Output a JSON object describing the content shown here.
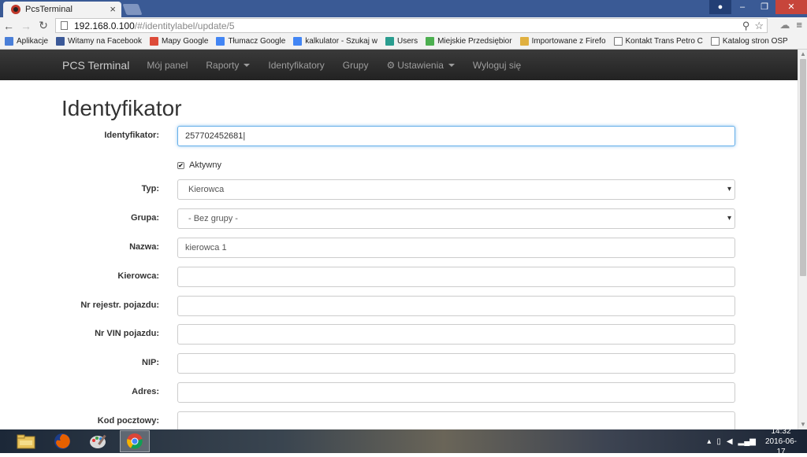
{
  "browser": {
    "tab_title": "PcsTerminal",
    "url_host": "192.168.0.100",
    "url_path": "/#/identitylabel/update/5",
    "bookmarks": [
      {
        "label": "Aplikacje",
        "icon": "apps-grid-icon",
        "color": "#4a7fd8"
      },
      {
        "label": "Witamy na Facebook",
        "icon": "facebook-icon",
        "color": "#3b5998"
      },
      {
        "label": "Mapy Google",
        "icon": "google-maps-icon",
        "color": "#dd4b39"
      },
      {
        "label": "Tłumacz Google",
        "icon": "google-translate-icon",
        "color": "#4285f4"
      },
      {
        "label": "kalkulator - Szukaj w",
        "icon": "google-g-icon",
        "color": "#4285f4"
      },
      {
        "label": "Users",
        "icon": "users-globe-icon",
        "color": "#2a9d8f"
      },
      {
        "label": "Miejskie Przedsiębior",
        "icon": "site-green-icon",
        "color": "#4caf50"
      },
      {
        "label": "Importowane z Firefo",
        "icon": "folder-icon",
        "color": "#e0b040"
      },
      {
        "label": "Kontakt Trans Petro C",
        "icon": "page-icon",
        "color": "#ffffff"
      },
      {
        "label": "Katalog stron OSP",
        "icon": "page-icon",
        "color": "#ffffff"
      }
    ]
  },
  "navbar": {
    "brand": "PCS Terminal",
    "items": [
      "Mój panel",
      "Raporty",
      "Identyfikatory",
      "Grupy",
      "Ustawienia",
      "Wyloguj się"
    ]
  },
  "page": {
    "title": "Identyfikator",
    "fields": {
      "identyfikator": {
        "label": "Identyfikator:",
        "value": "257702452681"
      },
      "aktywny": {
        "label": "Aktywny",
        "checked": true
      },
      "typ": {
        "label": "Typ:",
        "value": "Kierowca"
      },
      "grupa": {
        "label": "Grupa:",
        "value": "- Bez grupy -"
      },
      "nazwa": {
        "label": "Nazwa:",
        "value": "kierowca 1"
      },
      "kierowca": {
        "label": "Kierowca:",
        "value": ""
      },
      "nr_rejestr": {
        "label": "Nr rejestr. pojazdu:",
        "value": ""
      },
      "nr_vin": {
        "label": "Nr VIN pojazdu:",
        "value": ""
      },
      "nip": {
        "label": "NIP:",
        "value": ""
      },
      "adres": {
        "label": "Adres:",
        "value": ""
      },
      "kod_pocztowy": {
        "label": "Kod pocztowy:",
        "value": ""
      }
    }
  },
  "taskbar": {
    "time": "14:32",
    "date": "2016-06-17"
  },
  "colors": {
    "navbar_bg": "#222222",
    "focus_border": "#66afe9"
  }
}
